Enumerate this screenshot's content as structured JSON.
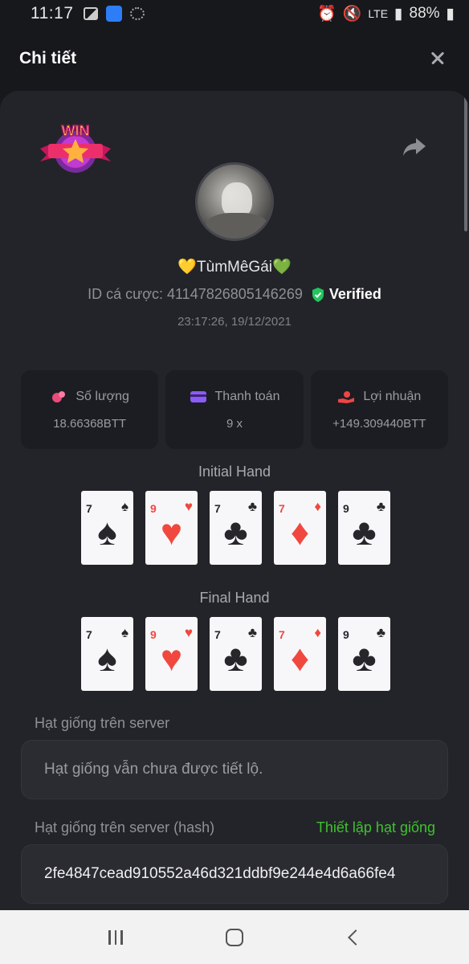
{
  "status_bar": {
    "time": "11:17",
    "network": "LTE",
    "battery": "88%"
  },
  "header": {
    "title": "Chi tiết"
  },
  "player": {
    "username": "💛TùmMêGái💚",
    "bet_id": "ID cá cược: 41147826805146269",
    "verified_label": "Verified",
    "timestamp": "23:17:26, 19/12/2021",
    "badge_text": "WIN"
  },
  "stats": [
    {
      "label": "Số lượng",
      "value": "18.66368BTT",
      "icon": "coins-icon",
      "color": "#e94b7a"
    },
    {
      "label": "Thanh toán",
      "value": "9 x",
      "icon": "card-payment-icon",
      "color": "#8b5cf6"
    },
    {
      "label": "Lợi nhuận",
      "value": "+149.309440BTT",
      "icon": "hand-money-icon",
      "color": "#ef4444"
    }
  ],
  "initial_hand": {
    "title": "Initial Hand",
    "cards": [
      {
        "rank": "7",
        "suit": "♠",
        "color": "black"
      },
      {
        "rank": "9",
        "suit": "♥",
        "color": "red"
      },
      {
        "rank": "7",
        "suit": "♣",
        "color": "black"
      },
      {
        "rank": "7",
        "suit": "♦",
        "color": "red"
      },
      {
        "rank": "9",
        "suit": "♣",
        "color": "black"
      }
    ]
  },
  "final_hand": {
    "title": "Final Hand",
    "cards": [
      {
        "rank": "7",
        "suit": "♠",
        "color": "black"
      },
      {
        "rank": "9",
        "suit": "♥",
        "color": "red"
      },
      {
        "rank": "7",
        "suit": "♣",
        "color": "black"
      },
      {
        "rank": "7",
        "suit": "♦",
        "color": "red"
      },
      {
        "rank": "9",
        "suit": "♣",
        "color": "black"
      }
    ]
  },
  "server_seed": {
    "label": "Hạt giống trên server",
    "placeholder": "Hạt giống vẫn chưa được tiết lộ."
  },
  "server_seed_hash": {
    "label": "Hạt giống trên server (hash)",
    "link": "Thiết lập hạt giống",
    "value": "2fe4847cead910552a46d321ddbf9e244e4d6a66fe4"
  }
}
